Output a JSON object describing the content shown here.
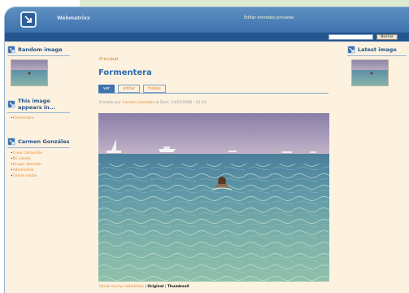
{
  "header": {
    "site_name": "Webmatrixx",
    "top_link": "Editar entradas privadas"
  },
  "search": {
    "placeholder": "",
    "button_label": "Buscar"
  },
  "sidebar_left": {
    "random_image": {
      "title": "Random image"
    },
    "appears_in": {
      "title": "This image appears in...",
      "items": [
        "Formentera"
      ]
    },
    "user_block": {
      "title": "Carmen Gonzáles",
      "items": [
        "Crear contenido",
        "Mi cuenta",
        "Grupo: abrmakr",
        "Administrar",
        "Cerrar sesión"
      ]
    }
  },
  "sidebar_right": {
    "latest_image": {
      "title": "Latest image"
    }
  },
  "main": {
    "breadcrumb": "Principal",
    "title": "Formentera",
    "tabs": [
      {
        "label": "ver",
        "active": true
      },
      {
        "label": "editar",
        "active": false
      },
      {
        "label": "trabas",
        "active": false
      }
    ],
    "submitted_prefix": "Enviado por",
    "submitted_author": "Carmen Gonzáles",
    "submitted_suffix": "el Dom, 14/05/2006 - 22:15",
    "photo_links": {
      "gallery": "Utado Isoorp coitadelian",
      "separator": "|",
      "original": "Original",
      "thumbnail": "Thumbnail"
    }
  },
  "colors": {
    "header_blue": "#3f73ad",
    "nav_dark_blue": "#23558f",
    "page_bg": "#fdf1e0",
    "link_orange": "#e48a2e",
    "title_blue": "#2c6aad"
  }
}
